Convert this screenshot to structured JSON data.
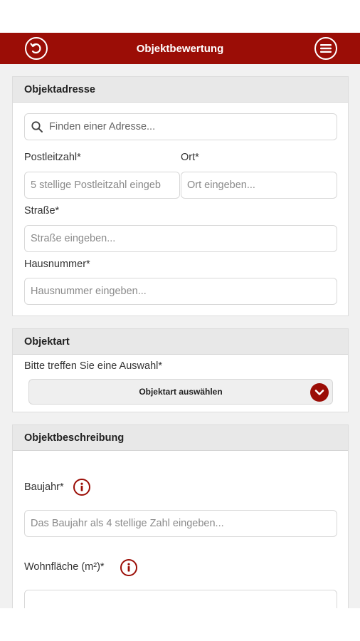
{
  "header": {
    "title": "Objektbewertung",
    "back_icon": "back-arrow-icon",
    "menu_icon": "menu-icon"
  },
  "colors": {
    "accent": "#9b0d06"
  },
  "objektadresse": {
    "heading": "Objektadresse",
    "search_placeholder": "Finden einer Adresse...",
    "plz_label": "Postleitzahl*",
    "plz_placeholder": "5 stellige Postleitzahl eingeb",
    "ort_label": "Ort*",
    "ort_placeholder": "Ort eingeben...",
    "strasse_label": "Straße*",
    "strasse_placeholder": "Straße eingeben...",
    "hausnummer_label": "Hausnummer*",
    "hausnummer_placeholder": "Hausnummer eingeben..."
  },
  "objektart": {
    "heading": "Objektart",
    "prompt": "Bitte treffen Sie eine Auswahl*",
    "select_label": "Objektart auswählen"
  },
  "objektbeschreibung": {
    "heading": "Objektbeschreibung",
    "baujahr_label": "Baujahr*",
    "baujahr_placeholder": "Das Baujahr als 4 stellige Zahl eingeben...",
    "wohnflaeche_label": "Wohnfläche (m²)*",
    "wohnflaeche_placeholder": ""
  }
}
